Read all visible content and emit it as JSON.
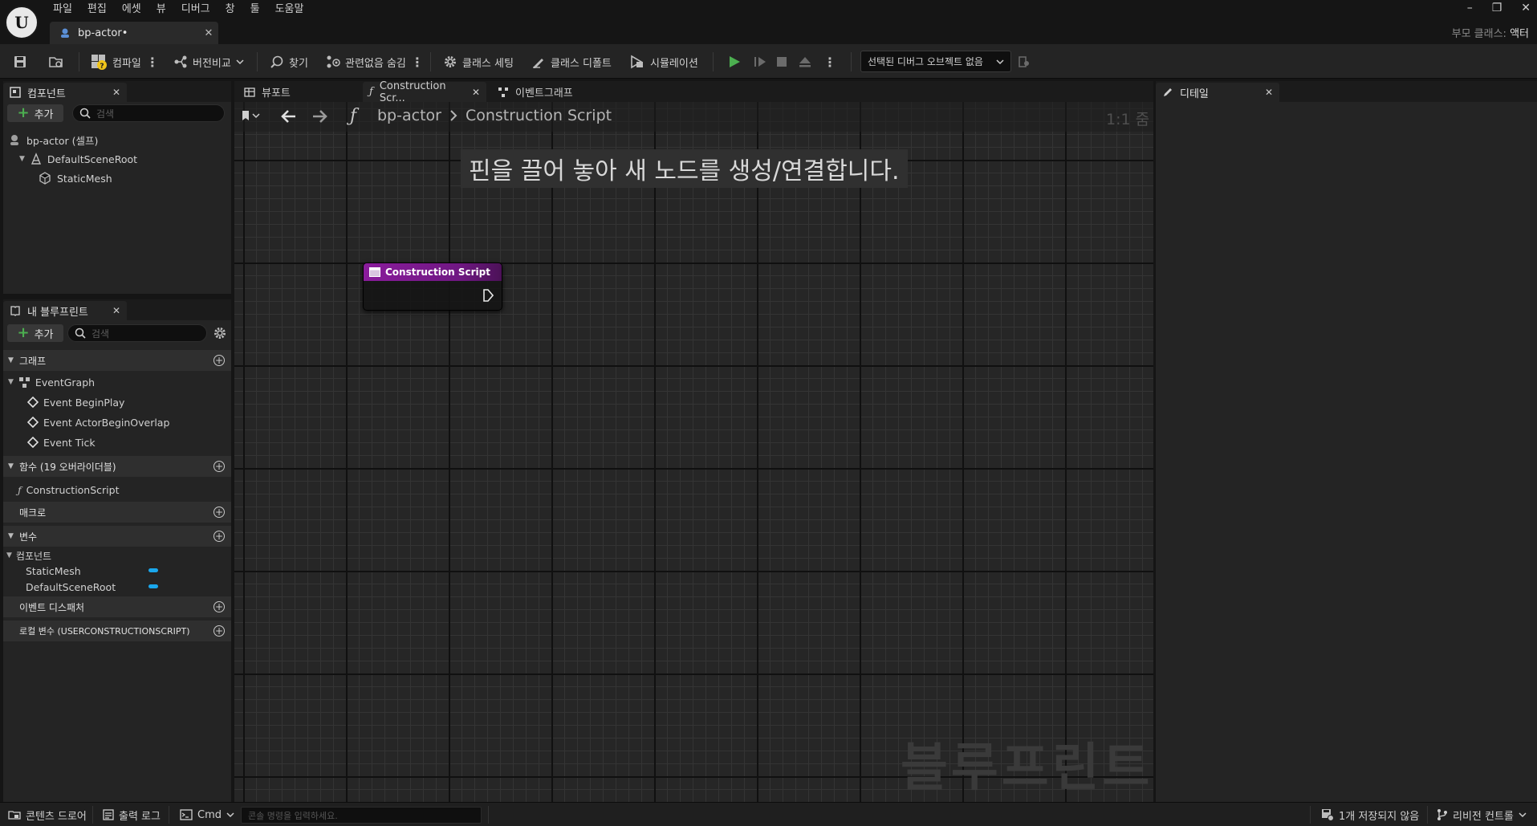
{
  "titlebar": {
    "menus": [
      "파일",
      "편집",
      "에셋",
      "뷰",
      "디버그",
      "창",
      "툴",
      "도움말"
    ],
    "doc_tab": "bp-actor•",
    "parent_class_label": "부모 클래스:",
    "parent_class_value": "액터"
  },
  "toolbar": {
    "compile": "컴파일",
    "diff": "버전비교",
    "find": "찾기",
    "hide_unrelated": "관련없음 숨김",
    "class_settings": "클래스 세팅",
    "class_defaults": "클래스 디폴트",
    "simulation": "시뮬레이션",
    "debug_object": "선택된 디버그 오브젝트 없음"
  },
  "components_panel": {
    "title": "컴포넌트",
    "add": "추가",
    "search_placeholder": "검색",
    "self": "bp-actor (셀프)",
    "root": "DefaultSceneRoot",
    "mesh": "StaticMesh"
  },
  "my_blueprint": {
    "title": "내 블루프린트",
    "add": "추가",
    "search_placeholder": "검색",
    "sections": {
      "graphs": "그래프",
      "functions": "함수 (19 오버라이더블)",
      "macros": "매크로",
      "variables": "변수",
      "components_cat": "컴포넌트",
      "event_dispatchers": "이벤트 디스패처",
      "local_vars": "로컬 변수 (USERCONSTRUCTIONSCRIPT)"
    },
    "event_graph": "EventGraph",
    "events": [
      "Event BeginPlay",
      "Event ActorBeginOverlap",
      "Event Tick"
    ],
    "function": "ConstructionScript",
    "variables": [
      "StaticMesh",
      "DefaultSceneRoot"
    ],
    "variable_color": "#1aa7ec"
  },
  "graph": {
    "tabs": [
      "뷰포트",
      "Construction Scr...",
      "이벤트그래프"
    ],
    "breadcrumb_root": "bp-actor",
    "breadcrumb_leaf": "Construction Script",
    "zoom": "1:1 줌",
    "hint": "핀을 끌어 놓아 새 노드를 생성/연결합니다.",
    "watermark": "블루프린트",
    "node_title": "Construction Script",
    "node_color": "#8a1c9c"
  },
  "details": {
    "title": "디테일"
  },
  "statusbar": {
    "content_drawer": "콘텐츠 드로어",
    "output_log": "출력 로그",
    "cmd": "Cmd",
    "console_placeholder": "콘솔 명령을 입력하세요.",
    "unsaved": "1개 저장되지 않음",
    "revision": "리비전 컨트롤"
  },
  "colors": {
    "play_green": "#4caf50",
    "accent_blue": "#1aa7ec"
  }
}
